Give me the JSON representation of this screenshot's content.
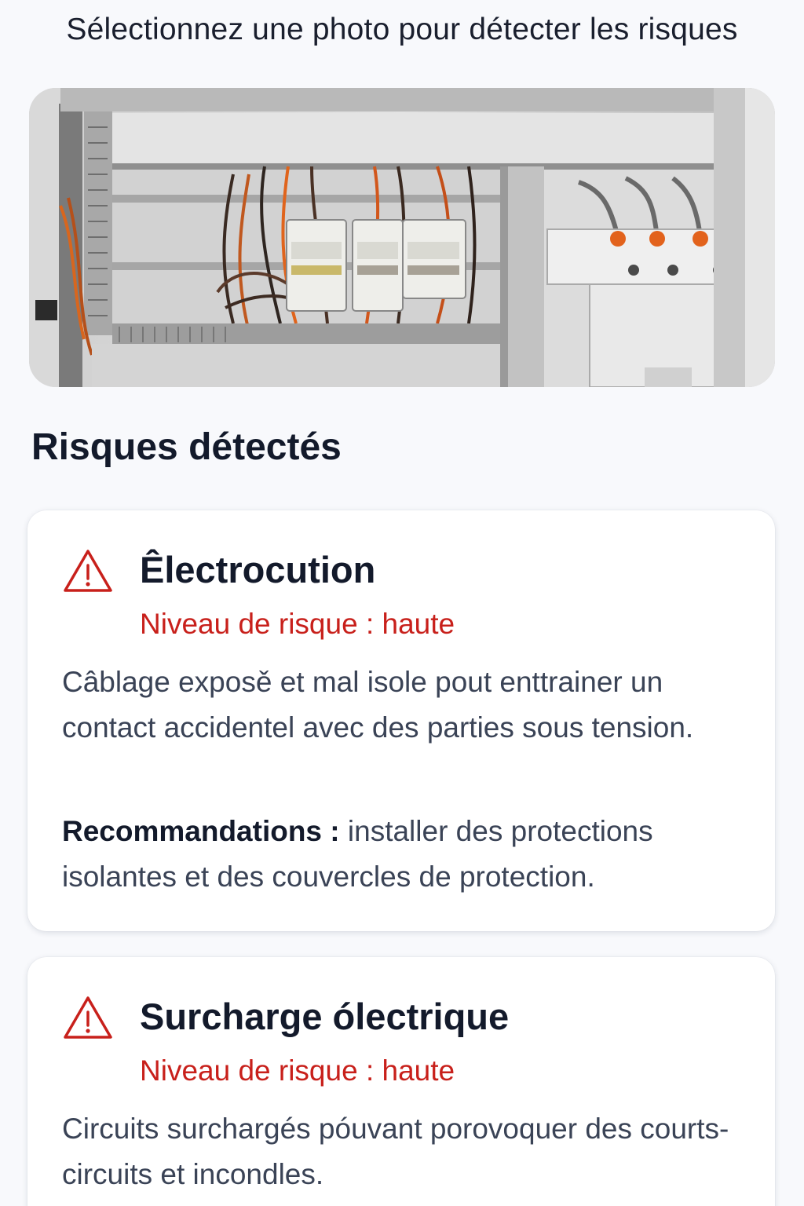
{
  "instruction": "Sélectionnez une photo pour détecter les risques",
  "section_title": "Risques détectés",
  "risks": [
    {
      "icon": "warning-triangle-icon",
      "title": "Êlectrocution",
      "level": "Niveau de risque : haute",
      "description": "Câblage exposě et mal isole pout enttrainer un contact accidentel avec des parties sous tension.",
      "recommendation_label": "Recommandations :",
      "recommendation_text": " installer des protections isolantes et des couvercles de protection."
    },
    {
      "icon": "warning-triangle-icon",
      "title": "Surcharge ólectrique",
      "level": "Niveau de risque : haute",
      "description": "Circuits surchargés póuvant porovoquer des courts-circuits et incondles."
    }
  ],
  "colors": {
    "background": "#f8f9fc",
    "danger": "#c8201b",
    "text_primary": "#131a2b",
    "text_secondary": "#3a4356"
  }
}
